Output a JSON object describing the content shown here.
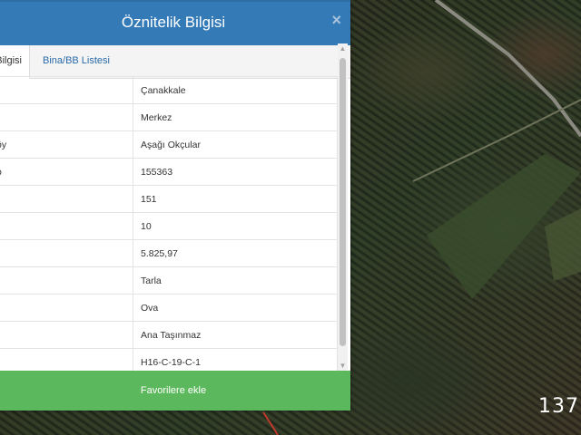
{
  "dialog": {
    "title": "Öznitelik Bilgisi",
    "close_glyph": "×",
    "tabs": [
      {
        "label": "Parsel Bilgisi",
        "visible_label": "Bilgisi"
      },
      {
        "label": "Bina/BB Listesi"
      }
    ],
    "rows": [
      {
        "key": "",
        "value": "Çanakkale"
      },
      {
        "key": "",
        "value": "Merkez"
      },
      {
        "key": "öy",
        "value": "Aşağı Okçular"
      },
      {
        "key": "o",
        "value": "155363"
      },
      {
        "key": "",
        "value": "151"
      },
      {
        "key": "",
        "value": "10"
      },
      {
        "key": "ı",
        "value": "5.825,97"
      },
      {
        "key": "",
        "value": "Tarla"
      },
      {
        "key": "",
        "value": "Ova"
      },
      {
        "key": "",
        "value": "Ana Taşınmaz"
      },
      {
        "key": "",
        "value": "H16-C-19-C-1"
      }
    ],
    "favorite_button": "Favorilere ekle",
    "scroll_up_glyph": "▲",
    "scroll_down_glyph": "▼"
  },
  "map": {
    "corner_label": "137",
    "colors": {
      "field_dark": "#2b3a26",
      "road": "#8a8a80",
      "parcel_line": "#c0392b"
    }
  },
  "colors": {
    "titlebar": "#337ab7",
    "button": "#5cb85c",
    "link": "#2a6aa8"
  }
}
